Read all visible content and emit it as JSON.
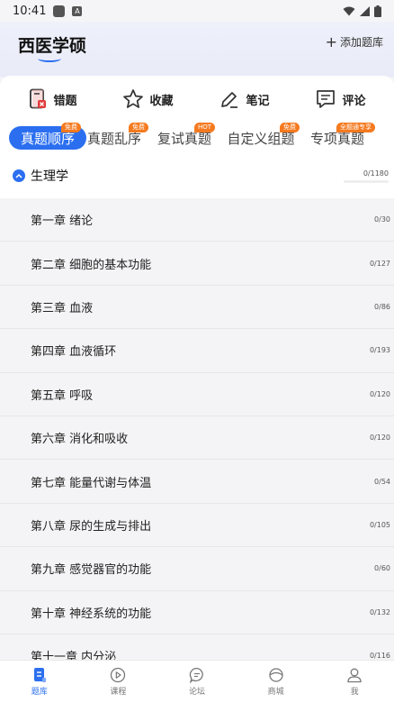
{
  "status_bar": {
    "time": "10:41",
    "a_badge": "A"
  },
  "header": {
    "title": "西医学硕",
    "add_bank_plus": "+",
    "add_bank_label": "添加题库"
  },
  "tools": [
    {
      "label": "错题",
      "icon": "wrong-questions-icon"
    },
    {
      "label": "收藏",
      "icon": "star-icon"
    },
    {
      "label": "笔记",
      "icon": "pen-icon"
    },
    {
      "label": "评论",
      "icon": "comment-icon"
    }
  ],
  "tabs": [
    {
      "label": "真题顺序",
      "badge": "免费",
      "active": true
    },
    {
      "label": "真题乱序",
      "badge": "免费",
      "active": false
    },
    {
      "label": "复试真题",
      "badge": "HOT",
      "active": false
    },
    {
      "label": "自定义组题",
      "badge": "免费",
      "active": false
    },
    {
      "label": "专项真题",
      "badge": "全题通专享",
      "active": false
    }
  ],
  "subject": {
    "name": "生理学",
    "count": "0/1180"
  },
  "chapters": [
    {
      "title": "第一章  绪论",
      "count": "0/30"
    },
    {
      "title": "第二章  细胞的基本功能",
      "count": "0/127"
    },
    {
      "title": "第三章  血液",
      "count": "0/86"
    },
    {
      "title": "第四章  血液循环",
      "count": "0/193"
    },
    {
      "title": "第五章  呼吸",
      "count": "0/120"
    },
    {
      "title": "第六章  消化和吸收",
      "count": "0/120"
    },
    {
      "title": "第七章  能量代谢与体温",
      "count": "0/54"
    },
    {
      "title": "第八章  尿的生成与排出",
      "count": "0/105"
    },
    {
      "title": "第九章 感觉器官的功能",
      "count": "0/60"
    },
    {
      "title": "第十章  神经系统的功能",
      "count": "0/132"
    },
    {
      "title": "第十一章  内分泌",
      "count": "0/116"
    }
  ],
  "bottom_nav": [
    {
      "label": "题库",
      "icon": "question-bank-icon",
      "active": true
    },
    {
      "label": "课程",
      "icon": "play-icon",
      "active": false
    },
    {
      "label": "论坛",
      "icon": "forum-icon",
      "active": false
    },
    {
      "label": "商城",
      "icon": "shop-icon",
      "active": false
    },
    {
      "label": "我",
      "icon": "user-icon",
      "active": false
    }
  ],
  "colors": {
    "accent": "#2b6ff0",
    "badge": "#f57a1f",
    "wrong_icon": "#e03c3c"
  }
}
